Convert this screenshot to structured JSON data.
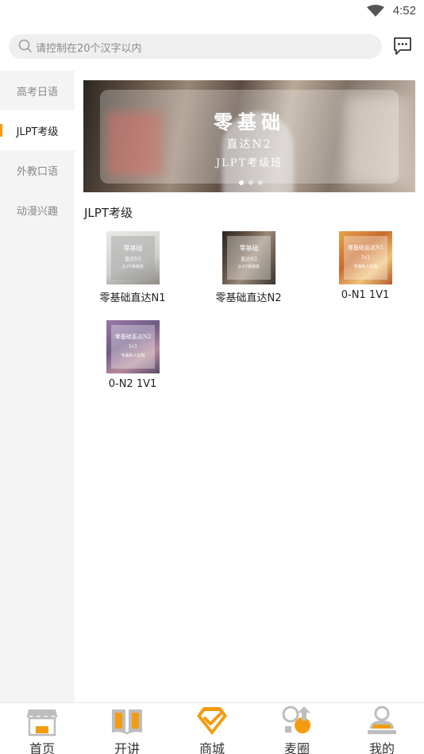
{
  "status": {
    "time": "4:52"
  },
  "search": {
    "placeholder": "请控制在20个汉字以内"
  },
  "sidebar": {
    "items": [
      {
        "label": "高考日语"
      },
      {
        "label": "JLPT考级"
      },
      {
        "label": "外教口语"
      },
      {
        "label": "动漫兴趣"
      }
    ],
    "active": "JLPT考级"
  },
  "banner": {
    "line1": "零基础",
    "line2": "直达N2",
    "line3": "JLPT考级班"
  },
  "section": {
    "title": "JLPT考级"
  },
  "products": [
    {
      "label": "零基础直达N1",
      "thumb_l1": "零基础",
      "thumb_l2": "直达N1",
      "thumb_l3": "JLPT考级班"
    },
    {
      "label": "零基础直达N2",
      "thumb_l1": "零基础",
      "thumb_l2": "直达N2",
      "thumb_l3": "JLPT考级班"
    },
    {
      "label": "0-N1 1V1",
      "thumb_l1": "零基础直达N1",
      "thumb_l2": "1v1",
      "thumb_l3": "专属私人定制"
    },
    {
      "label": "0-N2 1V1",
      "thumb_l1": "零基础直达N2",
      "thumb_l2": "1v1",
      "thumb_l3": "专属私人定制"
    }
  ],
  "nav": {
    "items": [
      {
        "label": "首页"
      },
      {
        "label": "开讲"
      },
      {
        "label": "商城"
      },
      {
        "label": "麦圈"
      },
      {
        "label": "我的"
      }
    ],
    "active": "商城"
  },
  "colors": {
    "accent": "#f39c12",
    "nav_icon": "#a9a9a9"
  },
  "icons": [
    "wifi-icon",
    "search-icon",
    "message-icon",
    "home-icon",
    "book-icon",
    "shop-check-icon",
    "circle-icon",
    "profile-icon"
  ]
}
